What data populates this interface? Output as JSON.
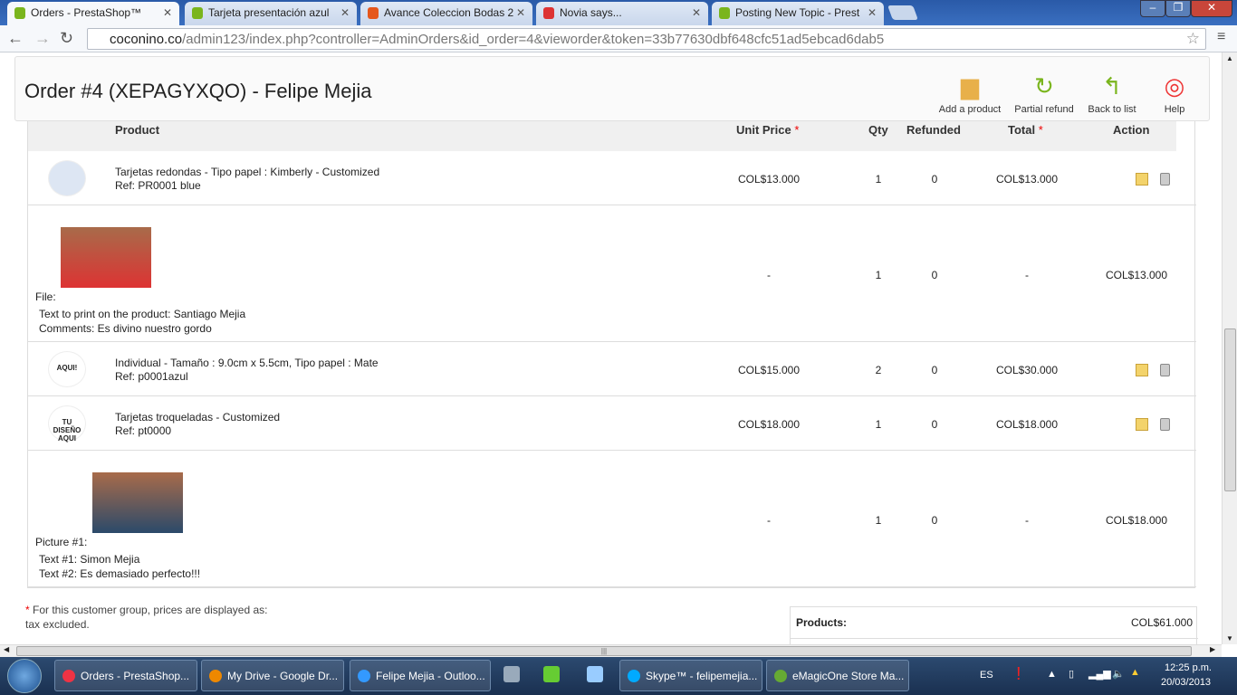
{
  "browser": {
    "tabs": [
      {
        "label": "Orders - PrestaShop™",
        "active": true,
        "icon": "prestashop-icon"
      },
      {
        "label": "Tarjeta presentación azul",
        "active": false,
        "icon": "prestashop-icon"
      },
      {
        "label": "Avance Coleccion Bodas 2",
        "active": false,
        "icon": "target-icon"
      },
      {
        "label": "Novia says...",
        "active": false,
        "icon": "gmail-icon"
      },
      {
        "label": "Posting New Topic - Prest",
        "active": false,
        "icon": "prestashop-icon"
      }
    ],
    "url_host": "coconino.co",
    "url_path": "/admin123/index.php?controller=AdminOrders&id_order=4&vieworder&token=33b77630dbf648cfc51ad5ebcad6dab5"
  },
  "page": {
    "title": "Order #4 (XEPAGYXQO) - Felipe Mejia",
    "toolbar": [
      {
        "label": "Add a product",
        "icon": "add-product-icon"
      },
      {
        "label": "Partial refund",
        "icon": "refund-icon"
      },
      {
        "label": "Back to list",
        "icon": "back-icon"
      },
      {
        "label": "Help",
        "icon": "help-lifebuoy-icon"
      }
    ],
    "columns": {
      "product": "Product",
      "unit_price": "Unit Price",
      "qty": "Qty",
      "refunded": "Refunded",
      "total": "Total",
      "action": "Action",
      "star": "*"
    },
    "rows": [
      {
        "name": "Tarjetas redondas - Tipo papel : Kimberly - Customized",
        "ref": "Ref: PR0001 blue",
        "unit_price": "COL$13.000",
        "qty": "1",
        "refunded": "0",
        "total": "COL$13.000"
      },
      {
        "custom": true,
        "label": "File:",
        "lines": [
          "Text to print on the product: Santiago Mejia",
          "Comments: Es divino nuestro gordo"
        ],
        "unit_price": "-",
        "qty": "1",
        "refunded": "0",
        "total": "-",
        "action": "COL$13.000"
      },
      {
        "name": "Individual - Tamaño : 9.0cm x 5.5cm, Tipo papel : Mate",
        "ref": "Ref: p0001azul",
        "unit_price": "COL$15.000",
        "qty": "2",
        "refunded": "0",
        "total": "COL$30.000",
        "thumb_text": "AQUI!"
      },
      {
        "name": "Tarjetas troqueladas - Customized",
        "ref": "Ref: pt0000",
        "unit_price": "COL$18.000",
        "qty": "1",
        "refunded": "0",
        "total": "COL$18.000",
        "thumb_text": "TU DISEÑO AQUI"
      },
      {
        "custom": true,
        "label": "Picture #1:",
        "lines": [
          "Text #1: Simon Mejia",
          "Text #2: Es demasiado perfecto!!!"
        ],
        "unit_price": "-",
        "qty": "1",
        "refunded": "0",
        "total": "-",
        "action": "COL$18.000"
      }
    ],
    "note_star": "*",
    "note": "For this customer group, prices are displayed as: tax excluded.",
    "summary": {
      "label": "Products:",
      "value": "COL$61.000"
    },
    "behind_header": "Products:"
  },
  "taskbar": {
    "items": [
      {
        "label": "Orders - PrestaShop...",
        "color": "#e34"
      },
      {
        "label": "My Drive - Google Dr...",
        "color": "#e80"
      },
      {
        "label": "Felipe Mejia - Outloo...",
        "color": "#39f"
      },
      {
        "label": "Skype™ - felipemejia...",
        "color": "#0af"
      },
      {
        "label": "eMagicOne Store Ma...",
        "color": "#6a3"
      }
    ],
    "lang": "ES",
    "time": "12:25 p.m.",
    "date": "20/03/2013"
  }
}
